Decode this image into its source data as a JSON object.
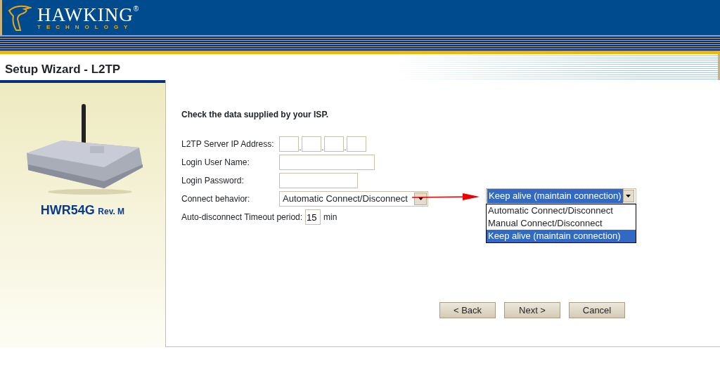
{
  "header": {
    "logo_name": "HAWKING",
    "logo_mark": "®",
    "logo_tagline": "TECHNOLOGY"
  },
  "page_title": "Setup Wizard - L2TP",
  "product": {
    "model": "HWR54G",
    "revision": "Rev. M"
  },
  "instruction": "Check the data supplied by your ISP.",
  "fields": [
    {
      "kind": "ip",
      "label": "L2TP Server IP Address:",
      "separators": [
        ".",
        ".",
        "."
      ]
    },
    {
      "kind": "text",
      "label": "Login User Name:"
    },
    {
      "kind": "password",
      "label": "Login Password:"
    },
    {
      "kind": "select",
      "label": "Connect behavior:",
      "value": "Automatic Connect/Disconnect"
    },
    {
      "kind": "timeout",
      "label": "Auto-disconnect Timeout period:",
      "value": "15",
      "unit": "min"
    }
  ],
  "dropdown_callout": {
    "value": "Keep alive (maintain connection)",
    "options": [
      {
        "label": "Automatic Connect/Disconnect",
        "selected": false
      },
      {
        "label": "Manual Connect/Disconnect",
        "selected": false
      },
      {
        "label": "Keep alive (maintain connection)",
        "selected": true
      }
    ]
  },
  "buttons": [
    "< Back",
    "Next >",
    "Cancel"
  ]
}
